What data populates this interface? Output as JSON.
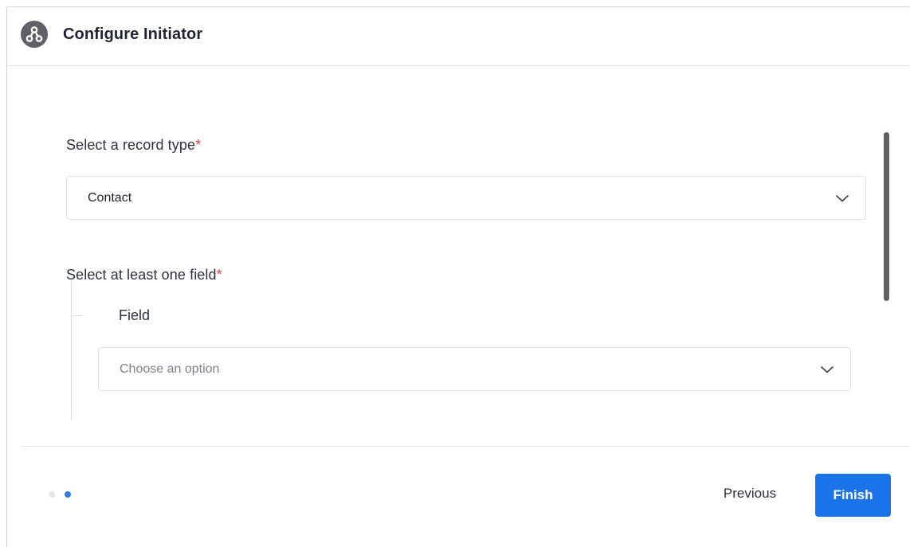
{
  "dialog": {
    "title": "Configure Initiator",
    "icon": "workflow-icon"
  },
  "record_type": {
    "label": "Select a record type",
    "required_mark": "*",
    "selected_value": "Contact",
    "icon": "chevron-down-icon"
  },
  "fields": {
    "label": "Select at least one field",
    "required_mark": "*",
    "field_label": "Field",
    "placeholder": "Choose an option",
    "icon": "chevron-down-icon"
  },
  "footer": {
    "steps_total": 2,
    "current_step": 2,
    "previous_label": "Previous",
    "finish_label": "Finish"
  },
  "colors": {
    "accent": "#1a73e8",
    "required": "#d94242",
    "step_active": "#2f7de1",
    "step_inactive": "#e4e6ea"
  }
}
